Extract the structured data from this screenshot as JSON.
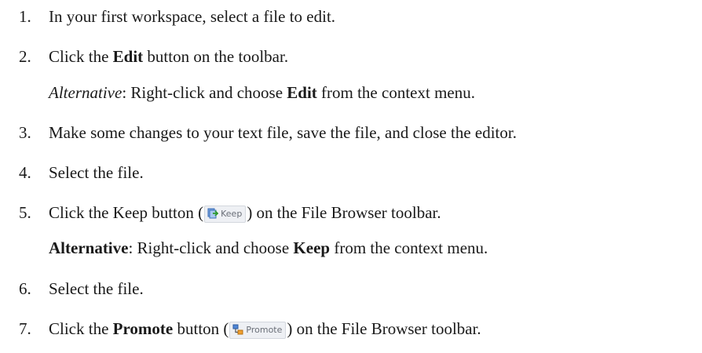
{
  "steps": [
    {
      "number": "1.",
      "text": "In your first workspace, select a file to edit."
    },
    {
      "number": "2.",
      "text_before": "Click the ",
      "bold": "Edit",
      "text_after": " button on the toolbar.",
      "alternative": {
        "label": "Alternative",
        "text_before": ": Right-click and choose ",
        "bold": "Edit",
        "text_after": " from the context menu."
      }
    },
    {
      "number": "3.",
      "text": "Make some changes to your text file, save the file, and close the editor."
    },
    {
      "number": "4.",
      "text": "Select the file."
    },
    {
      "number": "5.",
      "text_before": "Click the Keep button (",
      "button_label": "Keep",
      "button_icon": "keep-icon",
      "text_after": ") on the File Browser toolbar.",
      "alternative": {
        "label": "Alternative",
        "text_before": ": Right-click and choose ",
        "bold": "Keep",
        "text_after": " from the context menu."
      }
    },
    {
      "number": "6.",
      "text": "Select the file."
    },
    {
      "number": "7.",
      "text_before": "Click the ",
      "bold": "Promote",
      "text_mid": " button (",
      "button_label": "Promote",
      "button_icon": "promote-icon",
      "text_after": ") on the File Browser toolbar."
    }
  ]
}
